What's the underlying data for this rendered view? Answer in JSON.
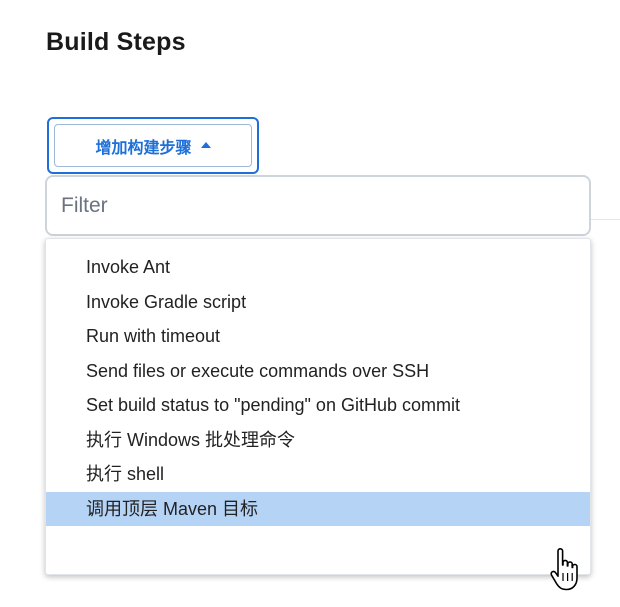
{
  "section": {
    "title": "Build Steps"
  },
  "add_step_button": {
    "label": "增加构建步骤"
  },
  "filter": {
    "placeholder": "Filter",
    "value": ""
  },
  "menu": {
    "items": [
      {
        "label": "Invoke Ant"
      },
      {
        "label": "Invoke Gradle script"
      },
      {
        "label": "Run with timeout"
      },
      {
        "label": "Send files or execute commands over SSH"
      },
      {
        "label": "Set build status to \"pending\" on GitHub commit"
      },
      {
        "label": "执行 Windows 批处理命令"
      },
      {
        "label": "执行 shell"
      },
      {
        "label": "调用顶层 Maven 目标"
      }
    ],
    "highlighted_item": "调用顶层 Maven 目标"
  },
  "colors": {
    "accent": "#1e6fd9",
    "highlight": "#b5d3f5",
    "input_border": "#cfd4da"
  },
  "icons": {
    "button_caret": "caret-up-icon",
    "mouse_cursor": "hand-pointer-cursor-icon"
  }
}
